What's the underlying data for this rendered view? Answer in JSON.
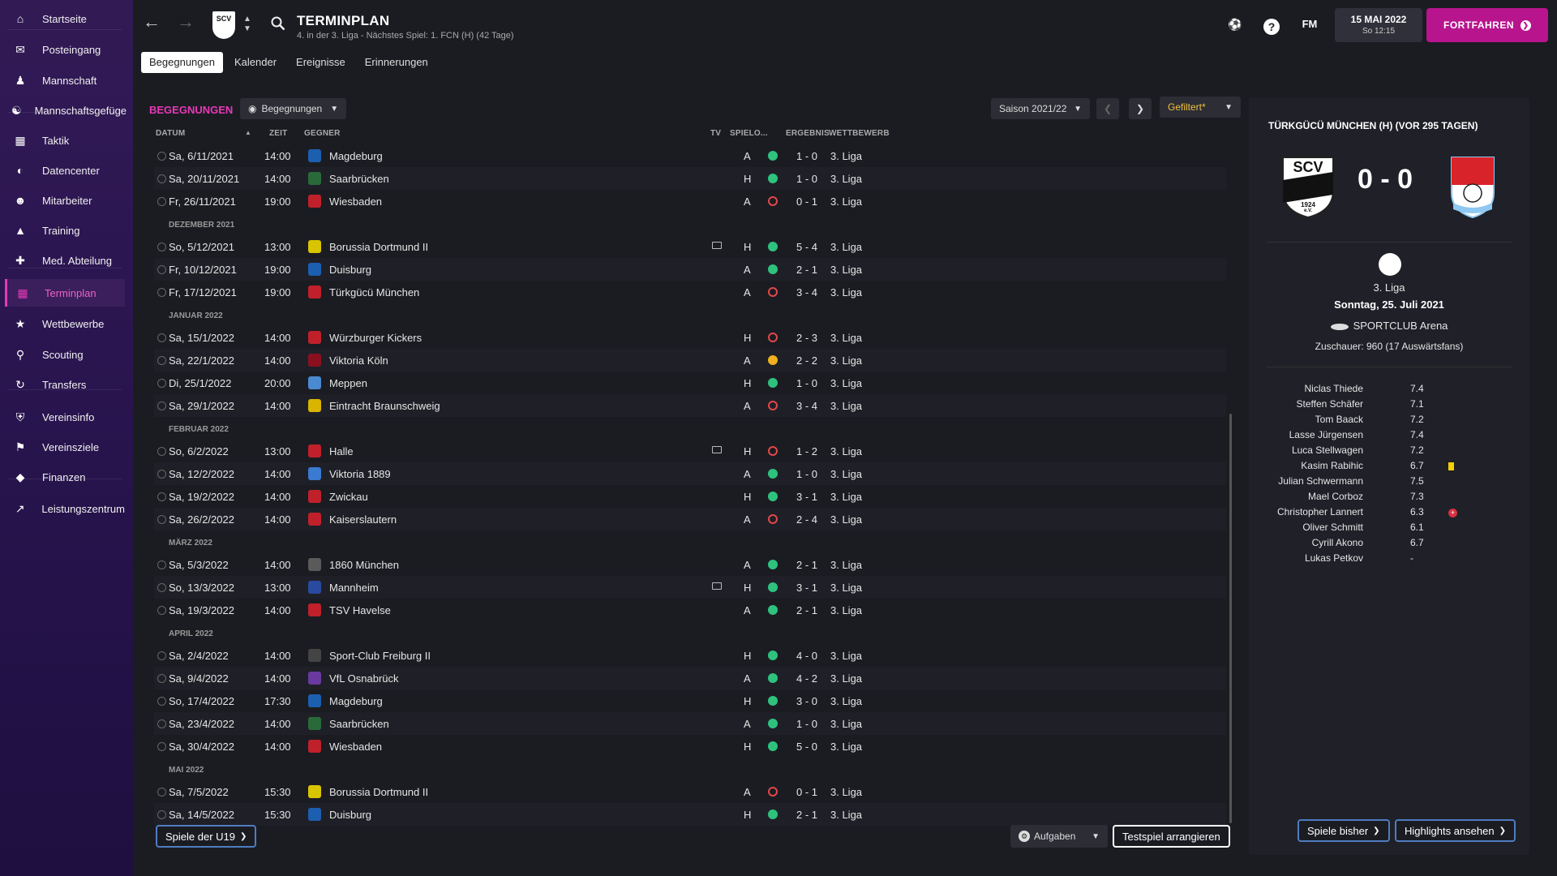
{
  "sidebar": {
    "items": [
      {
        "label": "Startseite",
        "icon": "home-icon"
      },
      {
        "label": "Posteingang",
        "icon": "inbox-icon"
      },
      {
        "label": "Mannschaft",
        "icon": "squad-icon"
      },
      {
        "label": "Mannschaftsgefüge",
        "icon": "dynamics-icon"
      },
      {
        "label": "Taktik",
        "icon": "tactics-icon"
      },
      {
        "label": "Datencenter",
        "icon": "data-icon"
      },
      {
        "label": "Mitarbeiter",
        "icon": "staff-icon"
      },
      {
        "label": "Training",
        "icon": "training-icon"
      },
      {
        "label": "Med. Abteilung",
        "icon": "medical-icon"
      },
      {
        "label": "Terminplan",
        "icon": "calendar-icon",
        "active": true
      },
      {
        "label": "Wettbewerbe",
        "icon": "trophy-icon"
      },
      {
        "label": "Scouting",
        "icon": "scouting-icon"
      },
      {
        "label": "Transfers",
        "icon": "transfers-icon"
      },
      {
        "label": "Vereinsinfo",
        "icon": "shield-icon"
      },
      {
        "label": "Vereinsziele",
        "icon": "goals-icon"
      },
      {
        "label": "Finanzen",
        "icon": "finance-icon"
      },
      {
        "label": "Leistungszentrum",
        "icon": "performance-icon"
      }
    ]
  },
  "header": {
    "title": "TERMINPLAN",
    "subtitle": "4. in der 3. Liga - Nächstes Spiel: 1. FCN (H) (42 Tage)",
    "club_crest": "SCV",
    "date_main": "15 MAI 2022",
    "date_sub": "So 12:15",
    "continue_label": "FORTFAHREN",
    "fm_label": "FM"
  },
  "tabs": [
    "Begegnungen",
    "Kalender",
    "Ereignisse",
    "Erinnerungen"
  ],
  "section": {
    "title": "BEGEGNUNGEN",
    "view_dropdown": "Begegnungen",
    "season": "Saison 2021/22",
    "filter": "Gefiltert*"
  },
  "columns": {
    "date": "DATUM",
    "time": "ZEIT",
    "opponent": "GEGNER",
    "tv": "TV",
    "venue": "SPIELO...",
    "result": "ERGEBNIS",
    "competition": "WETTBEWERB"
  },
  "fixtures": [
    {
      "type": "match",
      "date": "Sa, 6/11/2021",
      "time": "14:00",
      "opp": "Magdeburg",
      "crest": "#1c5fb0",
      "tv": false,
      "venue": "A",
      "outcome": "W",
      "score": "1 - 0",
      "comp": "3. Liga"
    },
    {
      "type": "match",
      "date": "Sa, 20/11/2021",
      "time": "14:00",
      "opp": "Saarbrücken",
      "crest": "#2a6a3a",
      "tv": false,
      "venue": "H",
      "outcome": "W",
      "score": "1 - 0",
      "comp": "3. Liga"
    },
    {
      "type": "match",
      "date": "Fr, 26/11/2021",
      "time": "19:00",
      "opp": "Wiesbaden",
      "crest": "#c0202a",
      "tv": false,
      "venue": "A",
      "outcome": "L",
      "score": "0 - 1",
      "comp": "3. Liga"
    },
    {
      "type": "month",
      "label": "DEZEMBER 2021"
    },
    {
      "type": "match",
      "date": "So, 5/12/2021",
      "time": "13:00",
      "opp": "Borussia Dortmund II",
      "crest": "#d9c400",
      "tv": true,
      "venue": "H",
      "outcome": "W",
      "score": "5 - 4",
      "comp": "3. Liga"
    },
    {
      "type": "match",
      "date": "Fr, 10/12/2021",
      "time": "19:00",
      "opp": "Duisburg",
      "crest": "#1c5fb0",
      "tv": false,
      "venue": "A",
      "outcome": "W",
      "score": "2 - 1",
      "comp": "3. Liga"
    },
    {
      "type": "match",
      "date": "Fr, 17/12/2021",
      "time": "19:00",
      "opp": "Türkgücü München",
      "crest": "#c0202a",
      "tv": false,
      "venue": "A",
      "outcome": "L",
      "score": "3 - 4",
      "comp": "3. Liga"
    },
    {
      "type": "month",
      "label": "JANUAR 2022"
    },
    {
      "type": "match",
      "date": "Sa, 15/1/2022",
      "time": "14:00",
      "opp": "Würzburger Kickers",
      "crest": "#c0202a",
      "tv": false,
      "venue": "H",
      "outcome": "L",
      "score": "2 - 3",
      "comp": "3. Liga"
    },
    {
      "type": "match",
      "date": "Sa, 22/1/2022",
      "time": "14:00",
      "opp": "Viktoria Köln",
      "crest": "#8a1020",
      "tv": false,
      "venue": "A",
      "outcome": "D",
      "score": "2 - 2",
      "comp": "3. Liga"
    },
    {
      "type": "match",
      "date": "Di, 25/1/2022",
      "time": "20:00",
      "opp": "Meppen",
      "crest": "#4a8ad0",
      "tv": false,
      "venue": "H",
      "outcome": "W",
      "score": "1 - 0",
      "comp": "3. Liga"
    },
    {
      "type": "match",
      "date": "Sa, 29/1/2022",
      "time": "14:00",
      "opp": "Eintracht Braunschweig",
      "crest": "#d9b400",
      "tv": false,
      "venue": "A",
      "outcome": "L",
      "score": "3 - 4",
      "comp": "3. Liga"
    },
    {
      "type": "month",
      "label": "FEBRUAR 2022"
    },
    {
      "type": "match",
      "date": "So, 6/2/2022",
      "time": "13:00",
      "opp": "Halle",
      "crest": "#c0202a",
      "tv": true,
      "venue": "H",
      "outcome": "L",
      "score": "1 - 2",
      "comp": "3. Liga"
    },
    {
      "type": "match",
      "date": "Sa, 12/2/2022",
      "time": "14:00",
      "opp": "Viktoria 1889",
      "crest": "#3a7ad0",
      "tv": false,
      "venue": "A",
      "outcome": "W",
      "score": "1 - 0",
      "comp": "3. Liga"
    },
    {
      "type": "match",
      "date": "Sa, 19/2/2022",
      "time": "14:00",
      "opp": "Zwickau",
      "crest": "#c0202a",
      "tv": false,
      "venue": "H",
      "outcome": "W",
      "score": "3 - 1",
      "comp": "3. Liga"
    },
    {
      "type": "match",
      "date": "Sa, 26/2/2022",
      "time": "14:00",
      "opp": "Kaiserslautern",
      "crest": "#c0202a",
      "tv": false,
      "venue": "A",
      "outcome": "L",
      "score": "2 - 4",
      "comp": "3. Liga"
    },
    {
      "type": "month",
      "label": "MÄRZ 2022"
    },
    {
      "type": "match",
      "date": "Sa, 5/3/2022",
      "time": "14:00",
      "opp": "1860 München",
      "crest": "#5a5a5a",
      "tv": false,
      "venue": "A",
      "outcome": "W",
      "score": "2 - 1",
      "comp": "3. Liga"
    },
    {
      "type": "match",
      "date": "So, 13/3/2022",
      "time": "13:00",
      "opp": "Mannheim",
      "crest": "#2a4aa0",
      "tv": true,
      "venue": "H",
      "outcome": "W",
      "score": "3 - 1",
      "comp": "3. Liga"
    },
    {
      "type": "match",
      "date": "Sa, 19/3/2022",
      "time": "14:00",
      "opp": "TSV Havelse",
      "crest": "#c0202a",
      "tv": false,
      "venue": "A",
      "outcome": "W",
      "score": "2 - 1",
      "comp": "3. Liga"
    },
    {
      "type": "month",
      "label": "APRIL 2022"
    },
    {
      "type": "match",
      "date": "Sa, 2/4/2022",
      "time": "14:00",
      "opp": "Sport-Club Freiburg II",
      "crest": "#444444",
      "tv": false,
      "venue": "H",
      "outcome": "W",
      "score": "4 - 0",
      "comp": "3. Liga"
    },
    {
      "type": "match",
      "date": "Sa, 9/4/2022",
      "time": "14:00",
      "opp": "VfL Osnabrück",
      "crest": "#6a3aa0",
      "tv": false,
      "venue": "A",
      "outcome": "W",
      "score": "4 - 2",
      "comp": "3. Liga"
    },
    {
      "type": "match",
      "date": "So, 17/4/2022",
      "time": "17:30",
      "opp": "Magdeburg",
      "crest": "#1c5fb0",
      "tv": false,
      "venue": "H",
      "outcome": "W",
      "score": "3 - 0",
      "comp": "3. Liga"
    },
    {
      "type": "match",
      "date": "Sa, 23/4/2022",
      "time": "14:00",
      "opp": "Saarbrücken",
      "crest": "#2a6a3a",
      "tv": false,
      "venue": "A",
      "outcome": "W",
      "score": "1 - 0",
      "comp": "3. Liga"
    },
    {
      "type": "match",
      "date": "Sa, 30/4/2022",
      "time": "14:00",
      "opp": "Wiesbaden",
      "crest": "#c0202a",
      "tv": false,
      "venue": "H",
      "outcome": "W",
      "score": "5 - 0",
      "comp": "3. Liga"
    },
    {
      "type": "month",
      "label": "MAI 2022"
    },
    {
      "type": "match",
      "date": "Sa, 7/5/2022",
      "time": "15:30",
      "opp": "Borussia Dortmund II",
      "crest": "#d9c400",
      "tv": false,
      "venue": "A",
      "outcome": "L",
      "score": "0 - 1",
      "comp": "3. Liga"
    },
    {
      "type": "match",
      "date": "Sa, 14/5/2022",
      "time": "15:30",
      "opp": "Duisburg",
      "crest": "#1c5fb0",
      "tv": false,
      "venue": "H",
      "outcome": "W",
      "score": "2 - 1",
      "comp": "3. Liga"
    }
  ],
  "bottom": {
    "u19_label": "Spiele der U19",
    "tasks_label": "Aufgaben",
    "friendly_label": "Testspiel arrangieren"
  },
  "match_panel": {
    "title": "TÜRKGÜCÜ MÜNCHEN (H) (VOR 295 TAGEN)",
    "home_crest_text": "SCV",
    "home_crest_year": "1924",
    "home_crest_ev": "e.V.",
    "score": "0 - 0",
    "competition": "3. Liga",
    "date": "Sonntag, 25. Juli 2021",
    "stadium": "SPORTCLUB Arena",
    "attendance": "Zuschauer: 960 (17 Auswärtsfans)",
    "players": [
      {
        "name": "Niclas Thiede",
        "rating": "7.4"
      },
      {
        "name": "Steffen Schäfer",
        "rating": "7.1"
      },
      {
        "name": "Tom Baack",
        "rating": "7.2"
      },
      {
        "name": "Lasse Jürgensen",
        "rating": "7.4"
      },
      {
        "name": "Luca Stellwagen",
        "rating": "7.2"
      },
      {
        "name": "Kasim Rabihic",
        "rating": "6.7",
        "event": "yellow-card"
      },
      {
        "name": "Julian Schwermann",
        "rating": "7.5"
      },
      {
        "name": "Mael Corboz",
        "rating": "7.3"
      },
      {
        "name": "Christopher Lannert",
        "rating": "6.3",
        "event": "injury"
      },
      {
        "name": "Oliver Schmitt",
        "rating": "6.1"
      },
      {
        "name": "Cyrill Akono",
        "rating": "6.7"
      },
      {
        "name": "Lukas Petkov",
        "rating": "-"
      }
    ],
    "btn_results": "Spiele bisher",
    "btn_highlights": "Highlights ansehen"
  },
  "colors": {
    "accent": "#e838b8",
    "win": "#2ec27e",
    "loss": "#e0484a",
    "draw": "#f0b020",
    "continue": "#b8148e"
  }
}
